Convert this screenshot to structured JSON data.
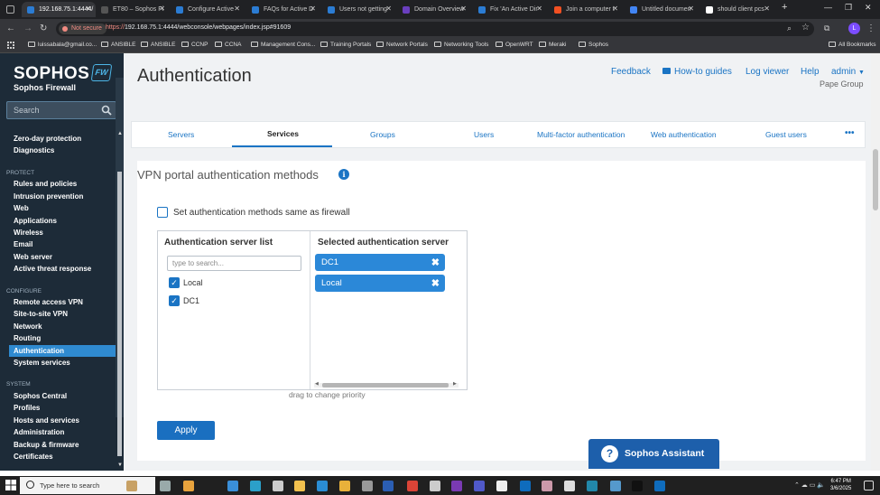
{
  "browser": {
    "tabs": [
      {
        "title": "192.168.75.1:4444/",
        "active": true,
        "color": "#2b7cd3"
      },
      {
        "title": "ET80 – Sophos Fi",
        "active": false,
        "color": "#555"
      },
      {
        "title": "Configure Active",
        "active": false,
        "color": "#2b7cd3"
      },
      {
        "title": "FAQs for Active D",
        "active": false,
        "color": "#2b7cd3"
      },
      {
        "title": "Users not getting",
        "active": false,
        "color": "#2b7cd3"
      },
      {
        "title": "Domain Overview",
        "active": false,
        "color": "#6a3fbf"
      },
      {
        "title": "Fix 'An Active Dir",
        "active": false,
        "color": "#2b7cd3"
      },
      {
        "title": "Join a computer t",
        "active": false,
        "color": "#f25022"
      },
      {
        "title": "Untitled documen",
        "active": false,
        "color": "#4285f4"
      },
      {
        "title": "should client pcs",
        "active": false,
        "color": "#ffffff"
      }
    ],
    "not_secure": "Not secure",
    "url_proto": "https://",
    "url_rest": "192.168.75.1:4444/webconsole/webpages/index.jsp#91609",
    "bookmarks": [
      "luissabala@gmail.co...",
      "ANSIBLE",
      "ANSIBLE",
      "CCNP",
      "CCNA",
      "Management Cons...",
      "Training Portals",
      "Network Portals",
      "Networking Tools",
      "OpenWRT",
      "Meraki",
      "Sophos"
    ],
    "all_bookmarks": "All Bookmarks"
  },
  "sidebar": {
    "logo": "SOPHOS",
    "logo_badge": "FW",
    "subtitle": "Sophos Firewall",
    "search_placeholder": "Search",
    "items_top": [
      "Zero-day protection",
      "Diagnostics"
    ],
    "protect_label": "PROTECT",
    "protect_items": [
      "Rules and policies",
      "Intrusion prevention",
      "Web",
      "Applications",
      "Wireless",
      "Email",
      "Web server",
      "Active threat response"
    ],
    "configure_label": "CONFIGURE",
    "configure_items": [
      "Remote access VPN",
      "Site-to-site VPN",
      "Network",
      "Routing",
      "Authentication",
      "System services"
    ],
    "system_label": "SYSTEM",
    "system_items": [
      "Sophos Central",
      "Profiles",
      "Hosts and services",
      "Administration",
      "Backup & firmware",
      "Certificates"
    ]
  },
  "header": {
    "title": "Authentication",
    "links": {
      "feedback": "Feedback",
      "howto": "How-to guides",
      "logviewer": "Log viewer",
      "help": "Help",
      "admin": "admin"
    },
    "org": "Pape Group"
  },
  "tabs": [
    "Servers",
    "Services",
    "Groups",
    "Users",
    "Multi-factor authentication",
    "Web authentication",
    "Guest users"
  ],
  "tabs_more": "•••",
  "section": {
    "title": "VPN portal authentication methods",
    "same_as_firewall": "Set authentication methods same as firewall",
    "server_list_head": "Authentication server list",
    "selected_head": "Selected authentication server",
    "search_placeholder": "type to search...",
    "available": [
      {
        "name": "Local",
        "checked": true
      },
      {
        "name": "DC1",
        "checked": true
      }
    ],
    "selected": [
      "DC1",
      "Local"
    ],
    "hint": "drag to change priority",
    "apply": "Apply"
  },
  "assistant": {
    "label": "Sophos Assistant"
  },
  "taskbar": {
    "search": "Type here to search",
    "time": "6:47 PM",
    "date": "3/6/2025"
  },
  "colors": {
    "accent": "#1a74c4",
    "sidebar_bg": "#1d2b38",
    "active_nav": "#2f8ad0"
  }
}
